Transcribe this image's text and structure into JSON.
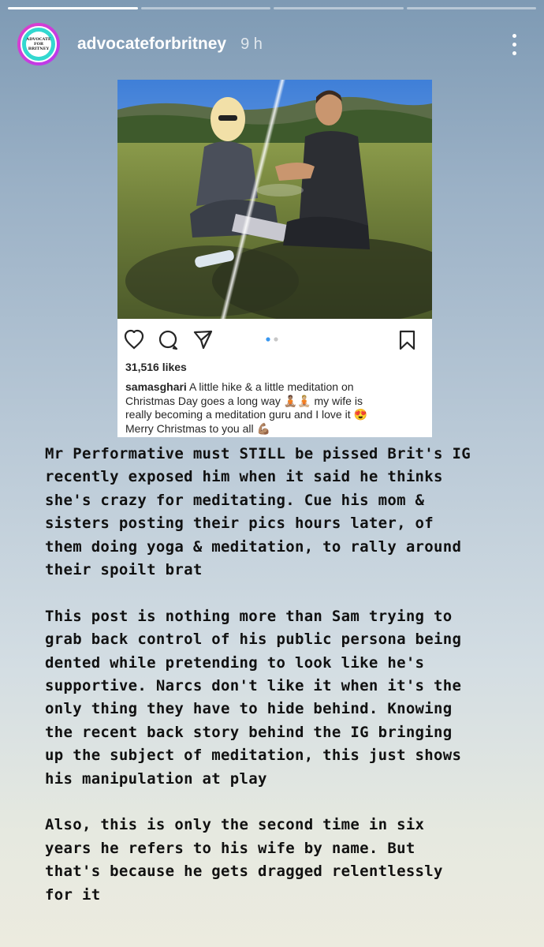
{
  "story": {
    "progress_segments": [
      true,
      false,
      false,
      false
    ],
    "username": "advocateforbritney",
    "time": "9 h",
    "avatar_text": "ADVOCATE FOR BRITNEY"
  },
  "post": {
    "likes": "31,516 likes",
    "caption_user": "samasghari",
    "caption_lines": [
      "A little hike & a little meditation on",
      "Christmas Day goes a long way 🧘🏽🧘🏼 my wife is",
      "really becoming a meditation guru and I love it 😍",
      "Merry Christmas to you all 💪🏽"
    ],
    "carousel_dots": 2,
    "icons": [
      "heart-icon",
      "comment-icon",
      "share-icon",
      "bookmark-icon"
    ]
  },
  "body_text": {
    "paragraph_1": [
      "Mr Performative must STILL be pissed Brit's IG",
      "recently exposed him when it said he thinks",
      "she's crazy for meditating. Cue his mom &",
      "sisters posting their pics hours later, of",
      "them doing yoga & meditation, to rally around",
      "their spoilt brat"
    ],
    "paragraph_2": [
      "This post is nothing more than Sam trying to",
      "grab back control of his public persona being",
      "dented while pretending to look like he's",
      "supportive. Narcs don't like it when it's the",
      "only thing they have to hide behind. Knowing",
      "the recent back story behind the IG bringing",
      "up the subject of meditation, this just shows",
      "his manipulation at play"
    ],
    "paragraph_3": [
      "Also, this is only the second time in six",
      "years he refers to his wife by name. But",
      "that's because he gets dragged relentlessly",
      "for it"
    ]
  },
  "colors": {
    "background_top": "#7e9ab4",
    "background_bottom": "#ecebdf",
    "avatar_ring": "#d43fd6",
    "avatar_fill": "#33d8d0",
    "carousel_active": "#3897f0"
  }
}
